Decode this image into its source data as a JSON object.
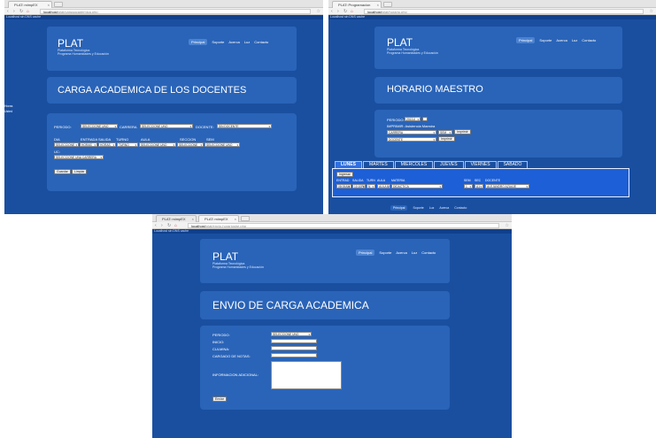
{
  "shot1": {
    "tabs": [
      "PLAT::mimpEX",
      ""
    ],
    "url_host": "localhost",
    "url_path": "/plat/cargaacademica.php",
    "status_text": "Localhost sin DNS cache",
    "brand_title": "PLAT",
    "brand_sub1": "Plataforma Tecnológica",
    "brand_sub2": "Programa Humanidades y Educación",
    "nav": [
      "Principal",
      "Soporte",
      "Acerca",
      "Luz",
      "Contacto"
    ],
    "page_title": "CARGA ACADEMICA DE LOS DOCENTES",
    "side_labels": [
      "Horas",
      "Usted"
    ],
    "form": {
      "periodo_label": "PERIODO:",
      "periodo_value": "SELECCIONE UNO",
      "carrera_label": "CARRERA",
      "carrera_value": "SELECCIONE UNO",
      "docente_label": "DOCENTE:",
      "docente_value": "SIN DOCENTE",
      "col_headers": [
        "DIA",
        "ENTRADA",
        "SALIDA",
        "TURNO",
        "AULA",
        "SECCION",
        "SEM"
      ],
      "row_values": [
        "SELECCIONE",
        "HORAS",
        "HORAS",
        "TURNO",
        "SELECCIONE UNO",
        "SELECCIONE",
        "SELECCIONE UNO"
      ],
      "uc_label": "UC:",
      "uc_value": "SELECCIONE UNA CARRERA",
      "btn_guardar": "Guardar",
      "btn_limpiar": "Limpiar"
    }
  },
  "shot2": {
    "tabs": [
      "PLAT::Programacion",
      ""
    ],
    "url_host": "localhost",
    "url_path": "/plat/horario.php",
    "status_text": "Localhost sin DNS cache",
    "brand_title": "PLAT",
    "brand_sub1": "Plataforma Tecnológica",
    "brand_sub2": "Programa Humanidades y Educación",
    "nav": [
      "Principal",
      "Soporte",
      "Acerca",
      "Luz",
      "Contacto"
    ],
    "page_title": "HORARIO MAESTRO",
    "form": {
      "periodo_label": "PERIODO:",
      "periodo_value": "2013-II",
      "imprimir_label": "IMPRIMIR: Asistencia Maestra",
      "carrera_value": "CARRERA",
      "sem_value": "SEM",
      "btn_imprimir1": "Imprimir",
      "docente_value": "DOCENTE",
      "btn_imprimir2": "Imprimir"
    },
    "days": [
      "LUNES",
      "MARTES",
      "MIERCOLES",
      "JUEVES",
      "VIERNES",
      "SABADO"
    ],
    "day_panel": {
      "btn_ingresar": "Ingresar",
      "col_headers": [
        "ENTRAD",
        "SALIDA",
        "TURN",
        "AULA",
        "MATERIA",
        "SEM",
        "SEC",
        "DOCENTE"
      ],
      "row": [
        "08:00AM",
        "10:10PM",
        "N",
        "AULA D",
        "DIDACTICA",
        "1",
        "A1",
        "ALEJANDRO AZUAJE"
      ]
    },
    "footer_nav": [
      "Principal",
      "Soporte",
      "Luz",
      "Acerca",
      "Contacto"
    ]
  },
  "shot3": {
    "tabs": [
      "PLAT::mimpEX",
      "PLAT::mimpEX"
    ],
    "url_host": "localhost",
    "url_path": "/plat/envio-horarioshe.php",
    "status_text": "Localhost sin DNS cache",
    "brand_title": "PLAT",
    "brand_sub1": "Plataforma Tecnológica",
    "brand_sub2": "Programa Humanidades y Educación",
    "nav": [
      "Principal",
      "Soporte",
      "Acerca",
      "Luz",
      "Contacto"
    ],
    "page_title": "ENVIO DE CARGA ACADEMICA",
    "form": {
      "periodo_label": "PERIODO:",
      "periodo_value": "SELECCIONE UNO",
      "inicio_label": "INICIO:",
      "culmina_label": "CULMINA:",
      "cargado_label": "CARGADO DE NOTAS:",
      "info_label": "INFORMACION ADICIONAL:",
      "btn_enviar": "Enviar"
    }
  },
  "colors": {
    "page_bg": "#1a4fa0",
    "panel_bg": "#2a64b8",
    "active_tab": "#2f6fe0"
  }
}
